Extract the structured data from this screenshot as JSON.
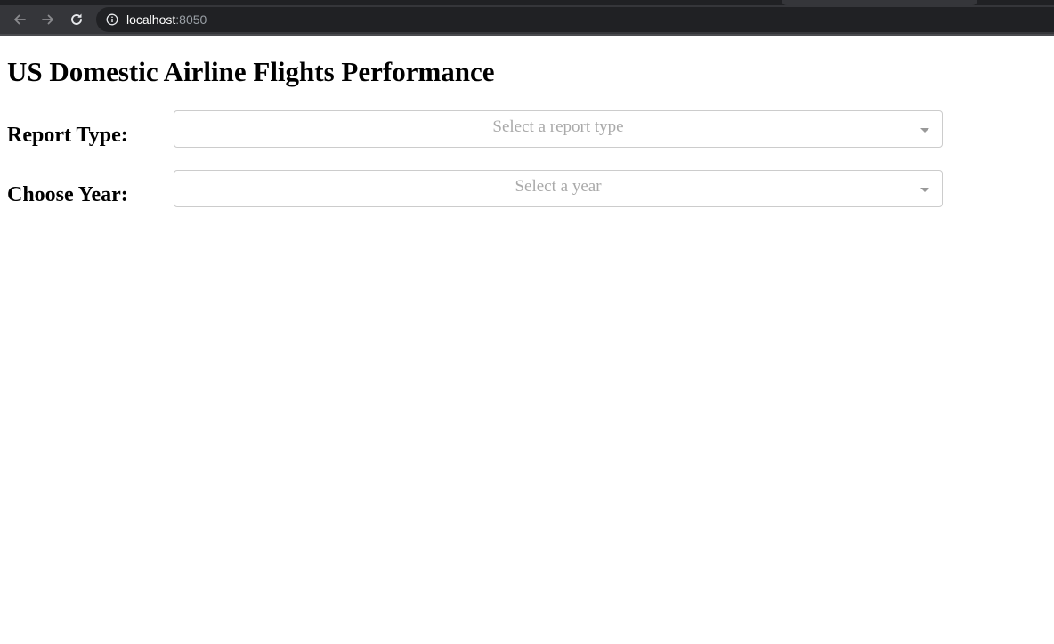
{
  "browser": {
    "url_host": "localhost",
    "url_port": ":8050",
    "icons": {
      "back": "arrow-left-icon",
      "forward": "arrow-right-icon",
      "reload": "reload-icon",
      "site_info": "info-icon"
    },
    "colors": {
      "toolbar": "#35363a",
      "omnibox": "#202124"
    }
  },
  "page": {
    "title": "US Domestic Airline Flights Performance",
    "report_type": {
      "label": "Report Type:",
      "placeholder": "Select a report type"
    },
    "year": {
      "label": "Choose Year:",
      "placeholder": "Select a year"
    }
  }
}
